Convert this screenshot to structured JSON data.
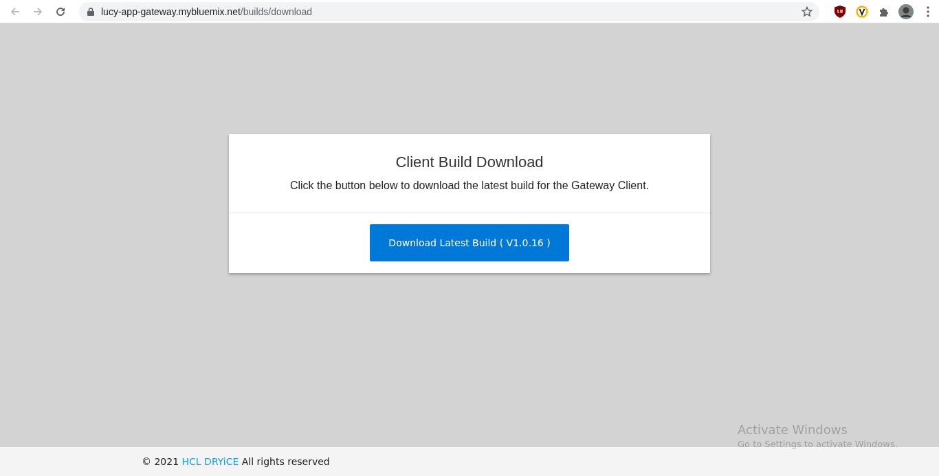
{
  "browser": {
    "url": {
      "host": "lucy-app-gateway.mybluemix.net",
      "path": "/builds/download"
    }
  },
  "card": {
    "title": "Client Build Download",
    "message": "Click the button below to download the latest build for the Gateway Client.",
    "button": "Download Latest Build ( V1.0.16 )"
  },
  "footer": {
    "copyright": "© 2021",
    "link": "HCL DRYiCE",
    "rights": "All rights reserved"
  },
  "os_notice": {
    "title": "Activate Windows",
    "subtitle": "Go to Settings to activate Windows."
  }
}
